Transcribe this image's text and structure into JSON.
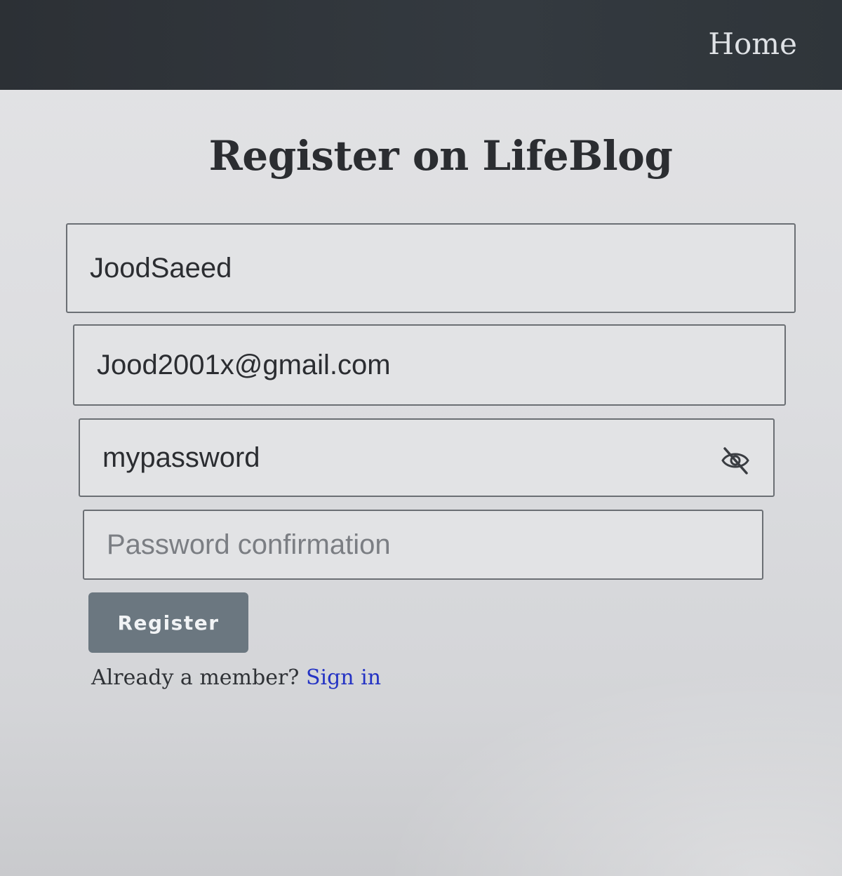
{
  "navbar": {
    "home_label": "Home"
  },
  "page": {
    "title": "Register on LifeBlog"
  },
  "form": {
    "username_value": "JoodSaeed",
    "email_value": "Jood2001x@gmail.com",
    "password_value": "mypassword",
    "password_toggle_icon": "eye-slash-icon",
    "confirm_placeholder": "Password confirmation",
    "confirm_value": "",
    "submit_label": "Register"
  },
  "footer": {
    "prompt": "Already a member?",
    "signin_label": "Sign in"
  },
  "colors": {
    "navbar": "#343a40",
    "button": "#6b7780",
    "link": "#2433c4"
  }
}
